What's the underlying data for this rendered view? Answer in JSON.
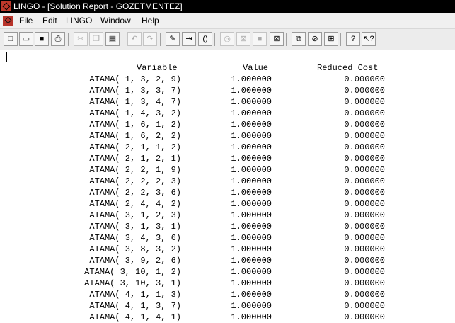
{
  "window": {
    "title": "LINGO - [Solution Report - GOZETMENTEZ]"
  },
  "menu": [
    "File",
    "Edit",
    "LINGO",
    "Window",
    "Help"
  ],
  "toolbar_icons": [
    {
      "name": "new-file-icon",
      "glyph": "□",
      "enabled": true
    },
    {
      "name": "open-folder-icon",
      "glyph": "▭",
      "enabled": true
    },
    {
      "name": "save-icon",
      "glyph": "■",
      "enabled": true
    },
    {
      "name": "print-icon",
      "glyph": "⎙",
      "enabled": true
    },
    {
      "name": "cut-icon",
      "glyph": "✂",
      "enabled": false
    },
    {
      "name": "copy-icon",
      "glyph": "❐",
      "enabled": false
    },
    {
      "name": "paste-icon",
      "glyph": "▤",
      "enabled": true
    },
    {
      "name": "undo-icon",
      "glyph": "↶",
      "enabled": false
    },
    {
      "name": "redo-icon",
      "glyph": "↷",
      "enabled": false
    },
    {
      "name": "find-icon",
      "glyph": "✎",
      "enabled": true
    },
    {
      "name": "goto-line-icon",
      "glyph": "⇥",
      "enabled": true
    },
    {
      "name": "match-parenthesis-icon",
      "glyph": "()",
      "enabled": true
    },
    {
      "name": "solve-icon",
      "glyph": "◎",
      "enabled": false
    },
    {
      "name": "solution-icon",
      "glyph": "⊠",
      "enabled": false
    },
    {
      "name": "stop-icon",
      "glyph": "■",
      "enabled": false
    },
    {
      "name": "close-all-icon",
      "glyph": "⊠",
      "enabled": true
    },
    {
      "name": "send-to-back-icon",
      "glyph": "⧉",
      "enabled": true
    },
    {
      "name": "close-window-icon",
      "glyph": "⊘",
      "enabled": true
    },
    {
      "name": "tile-icon",
      "glyph": "⊞",
      "enabled": true
    },
    {
      "name": "help-icon",
      "glyph": "?",
      "enabled": true
    },
    {
      "name": "context-help-icon",
      "glyph": "↖?",
      "enabled": true
    }
  ],
  "report": {
    "headers": {
      "variable": "Variable",
      "value": "Value",
      "reduced_cost": "Reduced Cost"
    },
    "rows": [
      {
        "variable": "ATAMA( 1, 3, 2, 9)",
        "value": "1.000000",
        "reduced_cost": "0.000000"
      },
      {
        "variable": "ATAMA( 1, 3, 3, 7)",
        "value": "1.000000",
        "reduced_cost": "0.000000"
      },
      {
        "variable": "ATAMA( 1, 3, 4, 7)",
        "value": "1.000000",
        "reduced_cost": "0.000000"
      },
      {
        "variable": "ATAMA( 1, 4, 3, 2)",
        "value": "1.000000",
        "reduced_cost": "0.000000"
      },
      {
        "variable": "ATAMA( 1, 6, 1, 2)",
        "value": "1.000000",
        "reduced_cost": "0.000000"
      },
      {
        "variable": "ATAMA( 1, 6, 2, 2)",
        "value": "1.000000",
        "reduced_cost": "0.000000"
      },
      {
        "variable": "ATAMA( 2, 1, 1, 2)",
        "value": "1.000000",
        "reduced_cost": "0.000000"
      },
      {
        "variable": "ATAMA( 2, 1, 2, 1)",
        "value": "1.000000",
        "reduced_cost": "0.000000"
      },
      {
        "variable": "ATAMA( 2, 2, 1, 9)",
        "value": "1.000000",
        "reduced_cost": "0.000000"
      },
      {
        "variable": "ATAMA( 2, 2, 2, 3)",
        "value": "1.000000",
        "reduced_cost": "0.000000"
      },
      {
        "variable": "ATAMA( 2, 2, 3, 6)",
        "value": "1.000000",
        "reduced_cost": "0.000000"
      },
      {
        "variable": "ATAMA( 2, 4, 4, 2)",
        "value": "1.000000",
        "reduced_cost": "0.000000"
      },
      {
        "variable": "ATAMA( 3, 1, 2, 3)",
        "value": "1.000000",
        "reduced_cost": "0.000000"
      },
      {
        "variable": "ATAMA( 3, 1, 3, 1)",
        "value": "1.000000",
        "reduced_cost": "0.000000"
      },
      {
        "variable": "ATAMA( 3, 4, 3, 6)",
        "value": "1.000000",
        "reduced_cost": "0.000000"
      },
      {
        "variable": "ATAMA( 3, 8, 3, 2)",
        "value": "1.000000",
        "reduced_cost": "0.000000"
      },
      {
        "variable": "ATAMA( 3, 9, 2, 6)",
        "value": "1.000000",
        "reduced_cost": "0.000000"
      },
      {
        "variable": "ATAMA( 3, 10, 1, 2)",
        "value": "1.000000",
        "reduced_cost": "0.000000"
      },
      {
        "variable": "ATAMA( 3, 10, 3, 1)",
        "value": "1.000000",
        "reduced_cost": "0.000000"
      },
      {
        "variable": "ATAMA( 4, 1, 1, 3)",
        "value": "1.000000",
        "reduced_cost": "0.000000"
      },
      {
        "variable": "ATAMA( 4, 1, 3, 7)",
        "value": "1.000000",
        "reduced_cost": "0.000000"
      },
      {
        "variable": "ATAMA( 4, 1, 4, 1)",
        "value": "1.000000",
        "reduced_cost": "0.000000"
      }
    ]
  }
}
